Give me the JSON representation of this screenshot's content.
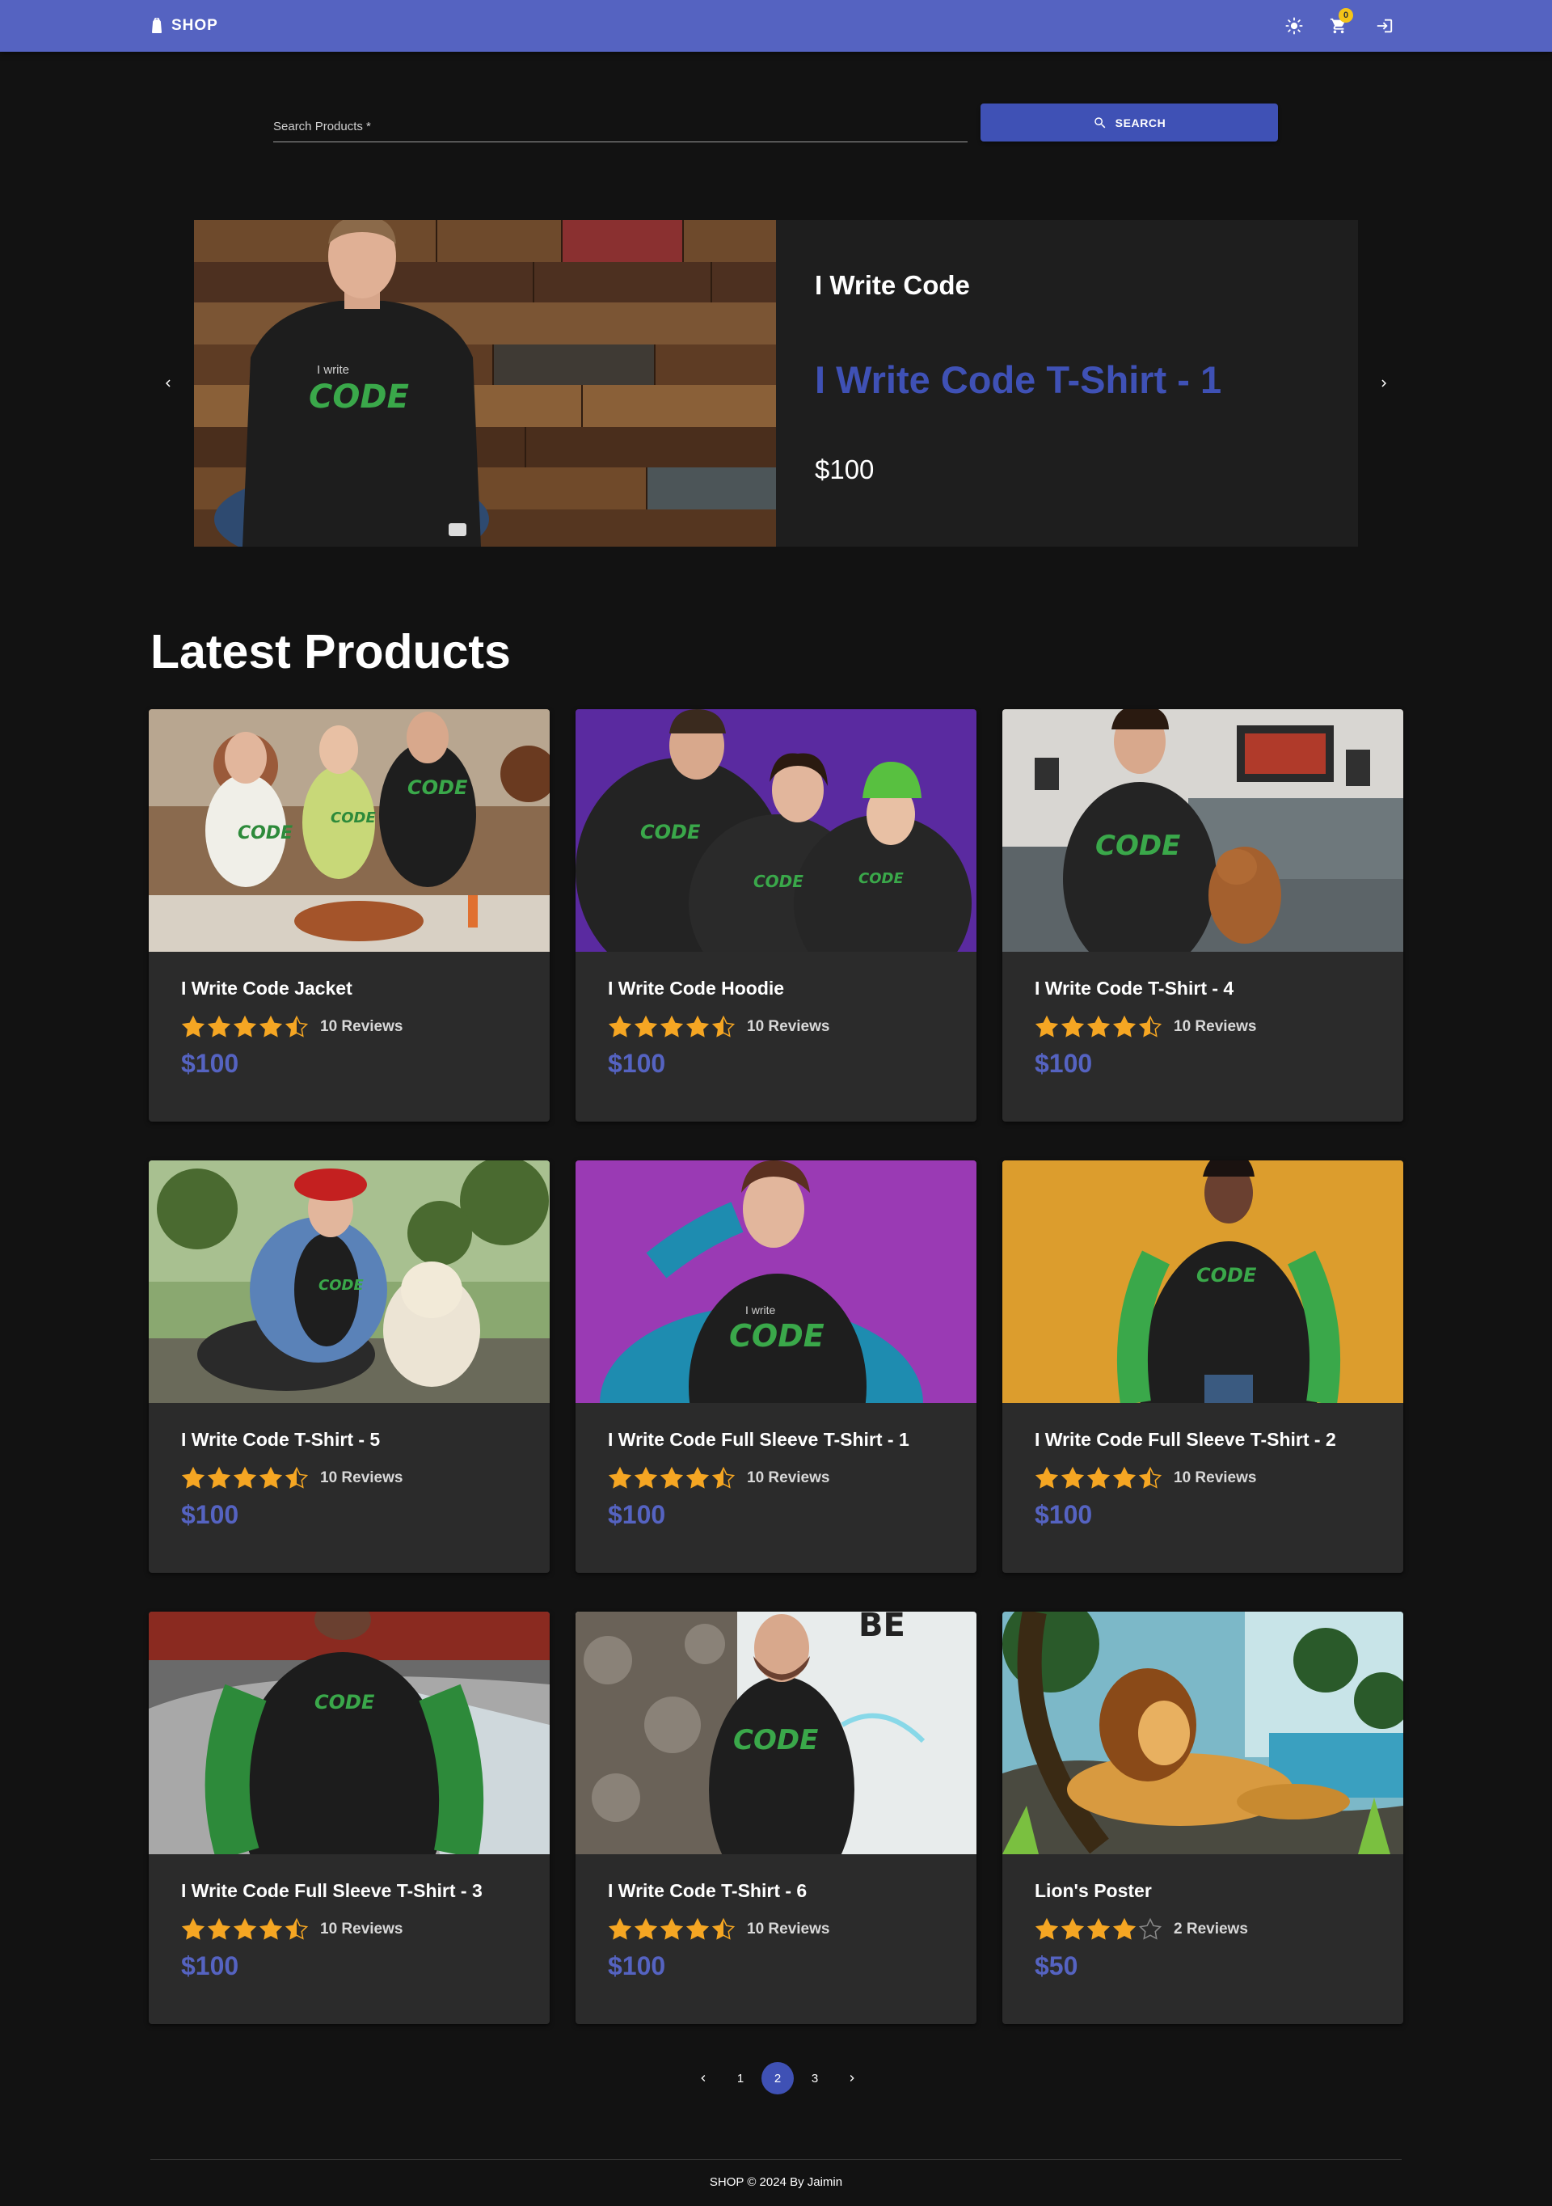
{
  "app": {
    "brand": "SHOP",
    "cart_count": "0",
    "icons": {
      "brand": "shop-logo-icon",
      "theme": "sun-icon",
      "cart": "cart-icon",
      "login": "login-icon"
    },
    "primary_color": "#3f51b5",
    "appbar_color": "#5563c1",
    "star_color": "#f5a623"
  },
  "search": {
    "label": "Search Products *",
    "value": "",
    "button_label": "SEARCH"
  },
  "carousel": {
    "subtitle": "I Write Code",
    "title": "I Write Code T-Shirt - 1",
    "price": "$100"
  },
  "latest": {
    "heading": "Latest Products",
    "products": [
      {
        "name": "I Write Code Jacket",
        "rating": 4.5,
        "reviews": "10 Reviews",
        "price": "$100"
      },
      {
        "name": "I Write Code Hoodie",
        "rating": 4.5,
        "reviews": "10 Reviews",
        "price": "$100"
      },
      {
        "name": "I Write Code T-Shirt - 4",
        "rating": 4.5,
        "reviews": "10 Reviews",
        "price": "$100"
      },
      {
        "name": "I Write Code T-Shirt - 5",
        "rating": 4.5,
        "reviews": "10 Reviews",
        "price": "$100"
      },
      {
        "name": "I Write Code Full Sleeve T-Shirt - 1",
        "rating": 4.5,
        "reviews": "10 Reviews",
        "price": "$100"
      },
      {
        "name": "I Write Code Full Sleeve T-Shirt - 2",
        "rating": 4.5,
        "reviews": "10 Reviews",
        "price": "$100"
      },
      {
        "name": "I Write Code Full Sleeve T-Shirt - 3",
        "rating": 4.5,
        "reviews": "10 Reviews",
        "price": "$100"
      },
      {
        "name": "I Write Code T-Shirt - 6",
        "rating": 4.5,
        "reviews": "10 Reviews",
        "price": "$100"
      },
      {
        "name": "Lion's Poster",
        "rating": 4,
        "reviews": "2 Reviews",
        "price": "$50"
      }
    ]
  },
  "pagination": {
    "pages": [
      "1",
      "2",
      "3"
    ],
    "current": "2"
  },
  "footer": {
    "text": "SHOP © 2024 By Jaimin"
  }
}
